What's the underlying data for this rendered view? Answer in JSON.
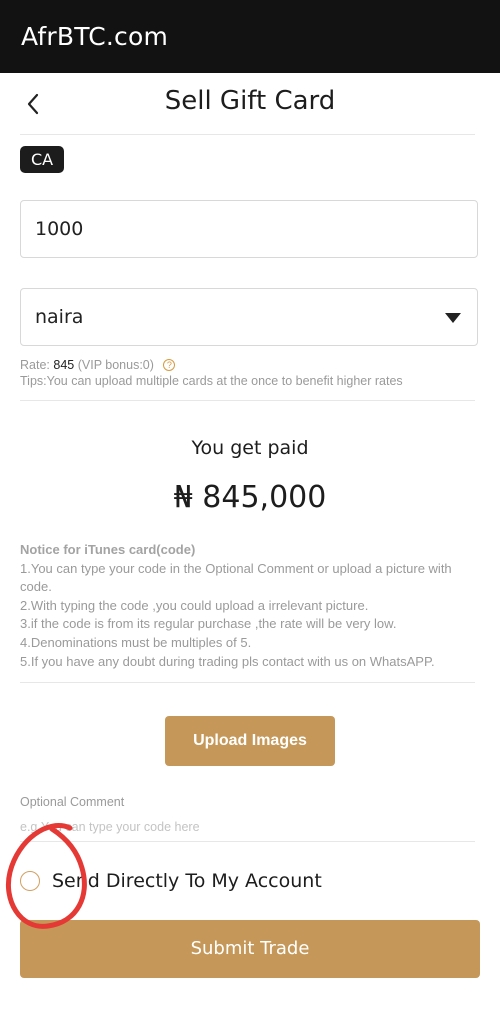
{
  "header": {
    "site_title": "AfrBTC.com"
  },
  "page": {
    "title": "Sell Gift Card",
    "back_icon": "chevron-left-icon"
  },
  "card": {
    "country_badge": "CA"
  },
  "form": {
    "amount_value": "1000",
    "currency_selected": "naira"
  },
  "rate": {
    "label": "Rate:",
    "value": "845",
    "vip": "(VIP bonus:0)",
    "help_icon": "question-circle-icon",
    "tips": "Tips:You can upload multiple cards at the once to benefit higher rates"
  },
  "payout": {
    "label": "You get paid",
    "amount": "₦ 845,000"
  },
  "notice": {
    "title": "Notice for iTunes card(code)",
    "lines": [
      "1.You can type your code in the Optional Comment or upload a picture with code.",
      "2.With typing the code ,you could upload a irrelevant picture.",
      "3.if the code is from its regular purchase ,the rate will be very low.",
      "4.Denominations must be multiples of 5.",
      "5.If you have any doubt during trading pls contact with us on WhatsAPP."
    ]
  },
  "actions": {
    "upload_label": "Upload Images",
    "comment_label": "Optional Comment",
    "comment_placeholder": "e.g.You can type your code here",
    "send_direct_label": "Send Directly To My Account",
    "submit_label": "Submit Trade"
  },
  "colors": {
    "accent": "#c59859",
    "topbar": "#121212",
    "annotation": "#e53935"
  }
}
